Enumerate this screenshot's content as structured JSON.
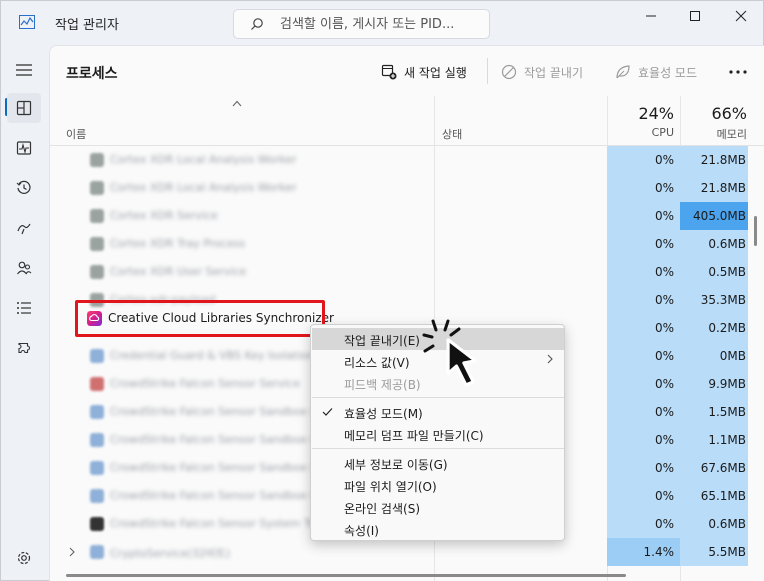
{
  "app": {
    "title": "작업 관리자",
    "search_placeholder": "검색할 이름, 게시자 또는 PID..."
  },
  "nav": [
    {
      "icon": "hamburger-icon",
      "label": "menu"
    },
    {
      "icon": "processes-icon",
      "label": "프로세스",
      "active": true
    },
    {
      "icon": "performance-icon",
      "label": "성능"
    },
    {
      "icon": "app-history-icon",
      "label": "앱 기록"
    },
    {
      "icon": "startup-apps-icon",
      "label": "시작 앱"
    },
    {
      "icon": "users-icon",
      "label": "사용자"
    },
    {
      "icon": "details-icon",
      "label": "세부 정보"
    },
    {
      "icon": "services-icon",
      "label": "서비스"
    },
    {
      "icon": "settings-icon",
      "label": "설정"
    }
  ],
  "toolbar": {
    "page_title": "프로세스",
    "new_task": "새 작업 실행",
    "end_task": "작업 끝내기",
    "efficiency_mode": "효율성 모드"
  },
  "table": {
    "headers": {
      "name": "이름",
      "status": "상태",
      "cpu_pct": "24%",
      "cpu": "CPU",
      "mem_pct": "66%",
      "mem": "메모리"
    },
    "rows": [
      {
        "name": "Cortex XDR Local Analysis Worker",
        "cpu": "0%",
        "mem": "21.8MB",
        "icon_color": "#9aa3a0"
      },
      {
        "name": "Cortex XDR Local Analysis Worker",
        "cpu": "0%",
        "mem": "21.8MB",
        "icon_color": "#9aa3a0"
      },
      {
        "name": "Cortex XDR Service",
        "cpu": "0%",
        "mem": "405.0MB",
        "icon_color": "#9aa3a0",
        "mem_hot": true
      },
      {
        "name": "Cortex XDR Tray Process",
        "cpu": "0%",
        "mem": "0.6MB",
        "icon_color": "#9aa3a0"
      },
      {
        "name": "Cortex XDR User Service",
        "cpu": "0%",
        "mem": "0.5MB",
        "icon_color": "#9aa3a0"
      },
      {
        "name": "Cortex-xdr-payload",
        "cpu": "0%",
        "mem": "35.3MB",
        "icon_color": "#9aa3a0"
      },
      {
        "name": "",
        "cpu": "0%",
        "mem": "0.2MB",
        "icon_color": "#ffffff"
      },
      {
        "name": "Credential Guard & VBS Key Isolation",
        "cpu": "0%",
        "mem": "0MB",
        "icon_color": "#8fb0d8"
      },
      {
        "name": "CrowdStrike Falcon Sensor Service",
        "cpu": "0%",
        "mem": "9.9MB",
        "icon_color": "#d07070"
      },
      {
        "name": "CrowdStrike Falcon Sensor Sandbox Co",
        "cpu": "0%",
        "mem": "1.5MB",
        "icon_color": "#8fb0d8"
      },
      {
        "name": "CrowdStrike Falcon Sensor Sandbox Co",
        "cpu": "0%",
        "mem": "1.1MB",
        "icon_color": "#8fb0d8"
      },
      {
        "name": "CrowdStrike Falcon Sensor Sandbox Co",
        "cpu": "0%",
        "mem": "67.6MB",
        "icon_color": "#8fb0d8"
      },
      {
        "name": "CrowdStrike Falcon Sensor Sandbox Co",
        "cpu": "0%",
        "mem": "65.1MB",
        "icon_color": "#8fb0d8"
      },
      {
        "name": "CrowdStrike Falcon Sensor System Tra",
        "cpu": "0%",
        "mem": "0.6MB",
        "icon_color": "#333333"
      },
      {
        "name": "CryptoService(32비트)",
        "cpu": "1.4%",
        "mem": "5.5MB",
        "icon_color": "#8fb0d8",
        "cpu_hot": true,
        "expandable": true
      }
    ]
  },
  "selected_process": "Creative Cloud Libraries Synchronizer",
  "context_menu": {
    "items": [
      {
        "label": "작업 끝내기(E)",
        "hover": true
      },
      {
        "label": "리소스 값(V)",
        "submenu": true
      },
      {
        "label": "피드백 제공(B)",
        "disabled": true
      },
      {
        "separator": true
      },
      {
        "label": "효율성 모드(M)",
        "checked": true
      },
      {
        "label": "메모리 덤프 파일 만들기(C)"
      },
      {
        "separator": true
      },
      {
        "label": "세부 정보로 이동(G)"
      },
      {
        "label": "파일 위치 열기(O)"
      },
      {
        "label": "온라인 검색(S)"
      },
      {
        "label": "속성(I)"
      }
    ]
  },
  "colors": {
    "accent": "#0f6cbd",
    "highlight_box": "#e0161c",
    "cpu_cell": "#b9dcf9",
    "mem_hot_cell": "#4ca3ee"
  }
}
